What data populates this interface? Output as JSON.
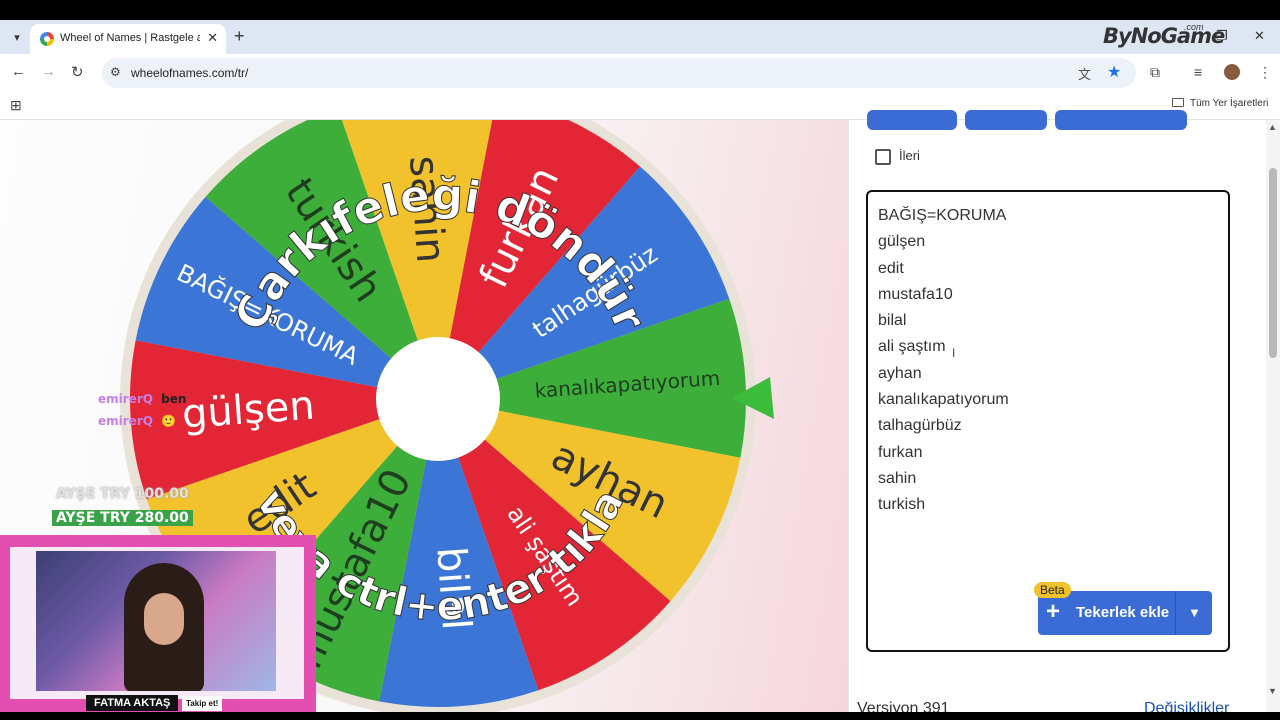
{
  "browser": {
    "tab_title": "Wheel of Names | Rastgele ad s",
    "url": "wheelofnames.com/tr/",
    "bookmarks_folder": "Tüm Yer İşaretleri",
    "overlay_brand": "ByNoGame",
    "overlay_brand_sup": ".com"
  },
  "wheel": {
    "center_color": "#ffffff",
    "pointer_color": "#3bbd3b",
    "overlay_top": "Çarkıfeleği döndür",
    "overlay_bottom": "veya ctrl+enter tıkla",
    "segments": [
      {
        "label": "kanalıkapatıyorum",
        "color": "#3dae3a"
      },
      {
        "label": "ayhan",
        "color": "#f2c22d"
      },
      {
        "label": "ali şaştım",
        "color": "#e32636"
      },
      {
        "label": "bilal",
        "color": "#3b76d6"
      },
      {
        "label": "mustafa10",
        "color": "#3dae3a"
      },
      {
        "label": "edit",
        "color": "#f2c22d"
      },
      {
        "label": "gülşen",
        "color": "#e32636"
      },
      {
        "label": "BAĞIŞ=KORUMA",
        "color": "#3b76d6"
      },
      {
        "label": "turkish",
        "color": "#3dae3a"
      },
      {
        "label": "sahin",
        "color": "#f2c22d"
      },
      {
        "label": "furkan",
        "color": "#e32636"
      },
      {
        "label": "talhagürbüz",
        "color": "#3b76d6"
      }
    ]
  },
  "panel": {
    "advanced_label": "İleri",
    "names": [
      "BAĞIŞ=KORUMA",
      "gülşen",
      "edit",
      "mustafa10",
      "bilal",
      "ali şaştım",
      "ayhan",
      "kanalıkapatıyorum",
      "talhagürbüz",
      "furkan",
      "sahin",
      "turkish"
    ],
    "add_wheel_label": "Tekerlek ekle",
    "beta_label": "Beta",
    "version_label": "Versiyon 391",
    "changes_label": "Değişiklikler"
  },
  "stream": {
    "chat": [
      {
        "user": "emirerQ",
        "message": "ben"
      },
      {
        "user": "emirerQ",
        "message": "🙂"
      }
    ],
    "donations": [
      {
        "text": "AYŞE TRY 100.00"
      },
      {
        "text": "AYŞE TRY 280.00"
      }
    ],
    "streamer_name": "FATMA AKTAŞ",
    "follow_label": "Takip et!"
  }
}
